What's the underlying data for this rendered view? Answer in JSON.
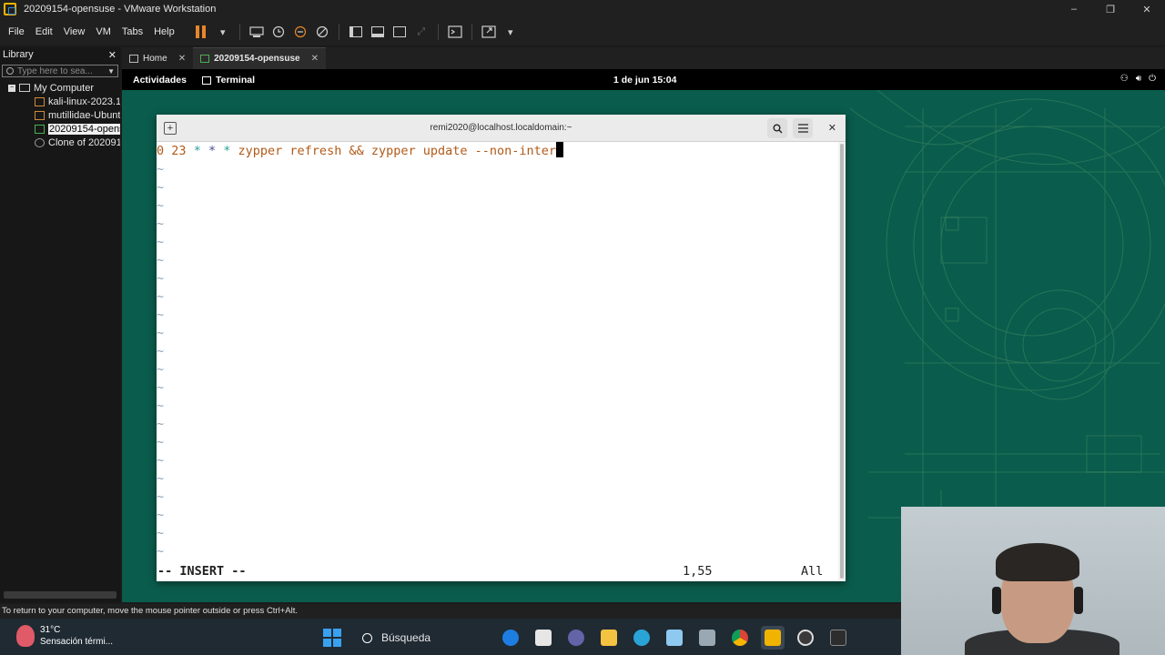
{
  "window": {
    "title": "20209154-opensuse - VMware Workstation",
    "controls": {
      "minimize": "–",
      "maximize": "❐",
      "close": "✕"
    }
  },
  "menu": [
    "File",
    "Edit",
    "View",
    "VM",
    "Tabs",
    "Help"
  ],
  "library": {
    "title": "Library",
    "close": "✕",
    "search_placeholder": "Type here to sea...",
    "root": "My Computer",
    "items": [
      "kali-linux-2023.1-",
      "mutillidae-Ubunt",
      "20209154-opensu",
      "Clone of 2020915"
    ],
    "selected_index": 2
  },
  "tabs": [
    {
      "label": "Home",
      "close": "✕"
    },
    {
      "label": "20209154-opensuse",
      "close": "✕"
    }
  ],
  "gnome": {
    "activities": "Actividades",
    "app": "Terminal",
    "clock": "1 de jun  15:04"
  },
  "terminal": {
    "title": "remi2020@localhost.localdomain:~",
    "line": {
      "minute": "0",
      "hour": "23",
      "dom": "*",
      "mon": "*",
      "dow": "*",
      "command": "zypper refresh && zypper update --non-inter"
    },
    "tilde_count": 22,
    "tilde": "~",
    "mode": "-- INSERT --",
    "position": "1,55",
    "scroll": "All"
  },
  "vm_status": "To return to your computer, move the mouse pointer outside or press Ctrl+Alt.",
  "taskbar": {
    "temp": "31°C",
    "weather_desc": "Sensación térmi...",
    "search": "Búsqueda"
  },
  "colors": {
    "desktop_bg": "#0a5c4c",
    "accent_orange": "#e8862a",
    "vim_number": "#b15a17",
    "vim_star": "#2aa198"
  }
}
